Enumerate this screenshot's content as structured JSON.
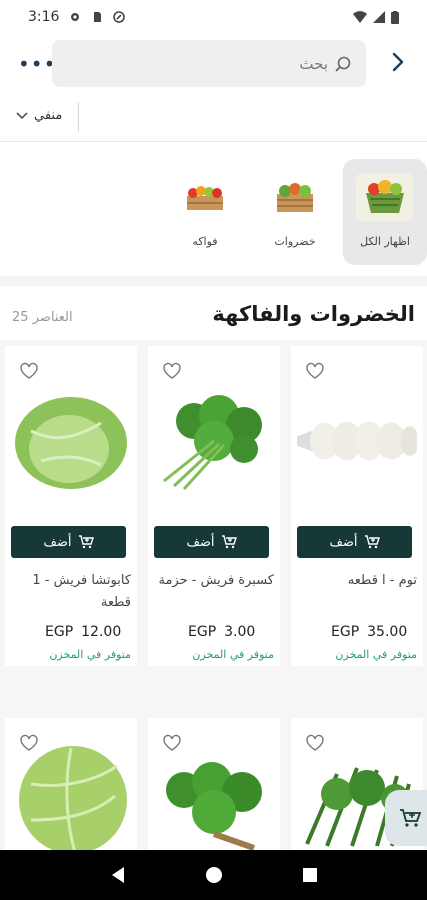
{
  "status_bar": {
    "time": "3:16"
  },
  "search": {
    "placeholder": "بحث"
  },
  "sort": {
    "label": "منفي"
  },
  "categories": [
    {
      "label": "اظهار الكل"
    },
    {
      "label": "خضروات"
    },
    {
      "label": "فواكه"
    }
  ],
  "section": {
    "title": "الخضروات والفاكهة",
    "count": "25 العناصر"
  },
  "products": [
    {
      "name": "توم - ا قطعه",
      "currency": "EGP",
      "price": "35.00",
      "stock": "متوفر في المخزن",
      "add_label": "أضف"
    },
    {
      "name": "كسبرة فريش - حزمة",
      "currency": "EGP",
      "price": "3.00",
      "stock": "متوفر في المخزن",
      "add_label": "أضف"
    },
    {
      "name": "كابوتشا فريش - 1 قطعة",
      "currency": "EGP",
      "price": "12.00",
      "stock": "متوفر في المخزن",
      "add_label": "أضف"
    }
  ],
  "colors": {
    "primary": "#163836",
    "accent": "#22a07a",
    "chip": "#e6e8ea"
  }
}
